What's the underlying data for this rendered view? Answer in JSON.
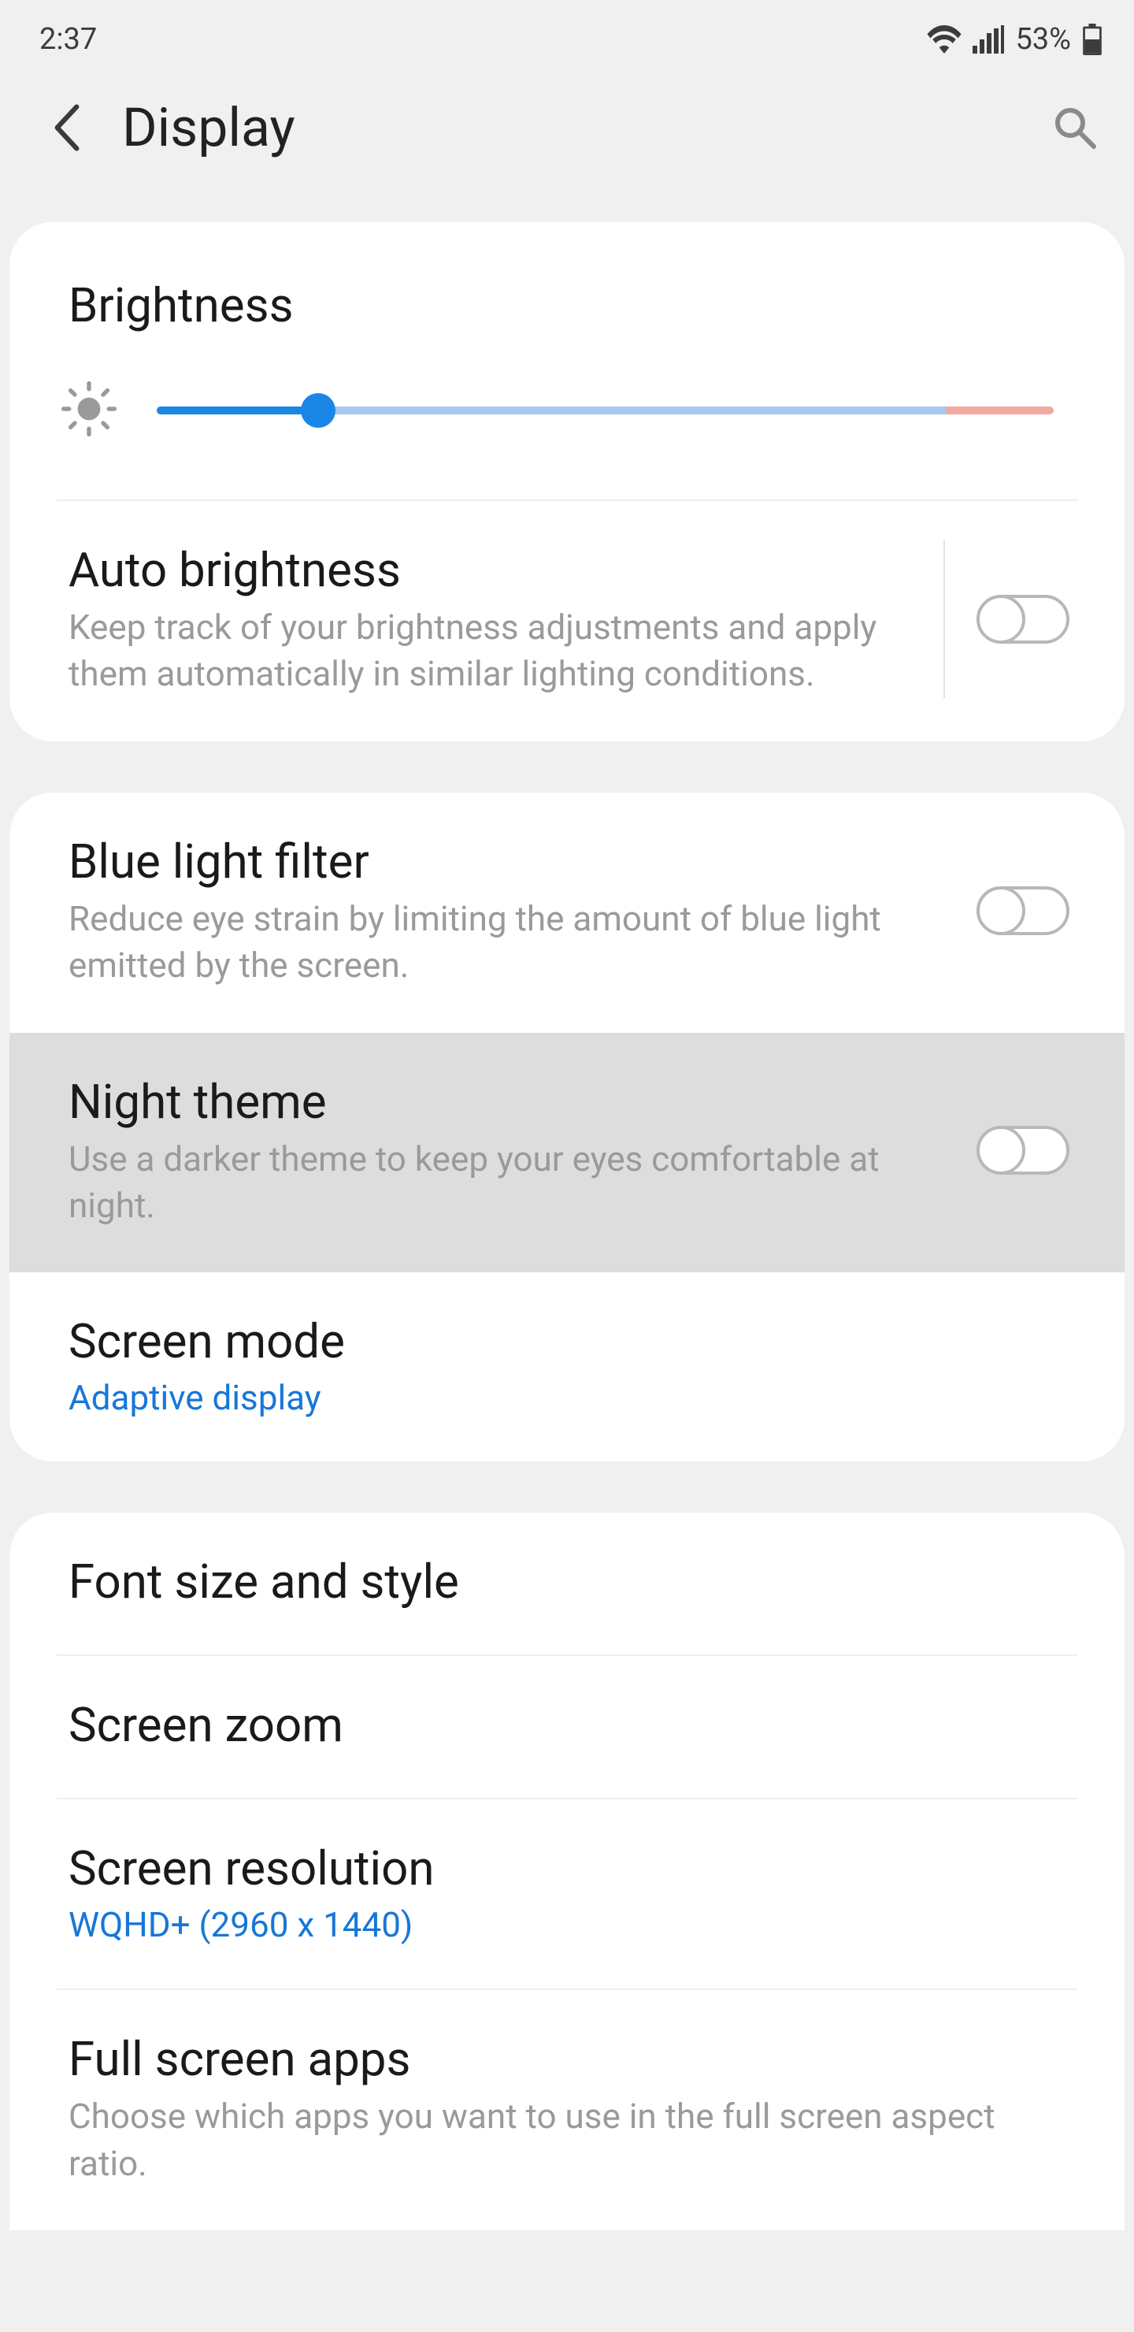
{
  "status": {
    "time": "2:37",
    "battery_pct": "53%"
  },
  "header": {
    "title": "Display"
  },
  "brightness": {
    "label": "Brightness",
    "value_pct": 18
  },
  "rows": {
    "auto_brightness": {
      "title": "Auto brightness",
      "sub": "Keep track of your brightness adjustments and apply them automatically in similar lighting conditions.",
      "on": false
    },
    "blue_light": {
      "title": "Blue light filter",
      "sub": "Reduce eye strain by limiting the amount of blue light emitted by the screen.",
      "on": false
    },
    "night_theme": {
      "title": "Night theme",
      "sub": "Use a darker theme to keep your eyes comfortable at night.",
      "on": false
    },
    "screen_mode": {
      "title": "Screen mode",
      "value": "Adaptive display"
    },
    "font": {
      "title": "Font size and style"
    },
    "zoom": {
      "title": "Screen zoom"
    },
    "resolution": {
      "title": "Screen resolution",
      "value": "WQHD+ (2960 x 1440)"
    },
    "fullscreen": {
      "title": "Full screen apps",
      "sub": "Choose which apps you want to use in the full screen aspect ratio."
    }
  }
}
